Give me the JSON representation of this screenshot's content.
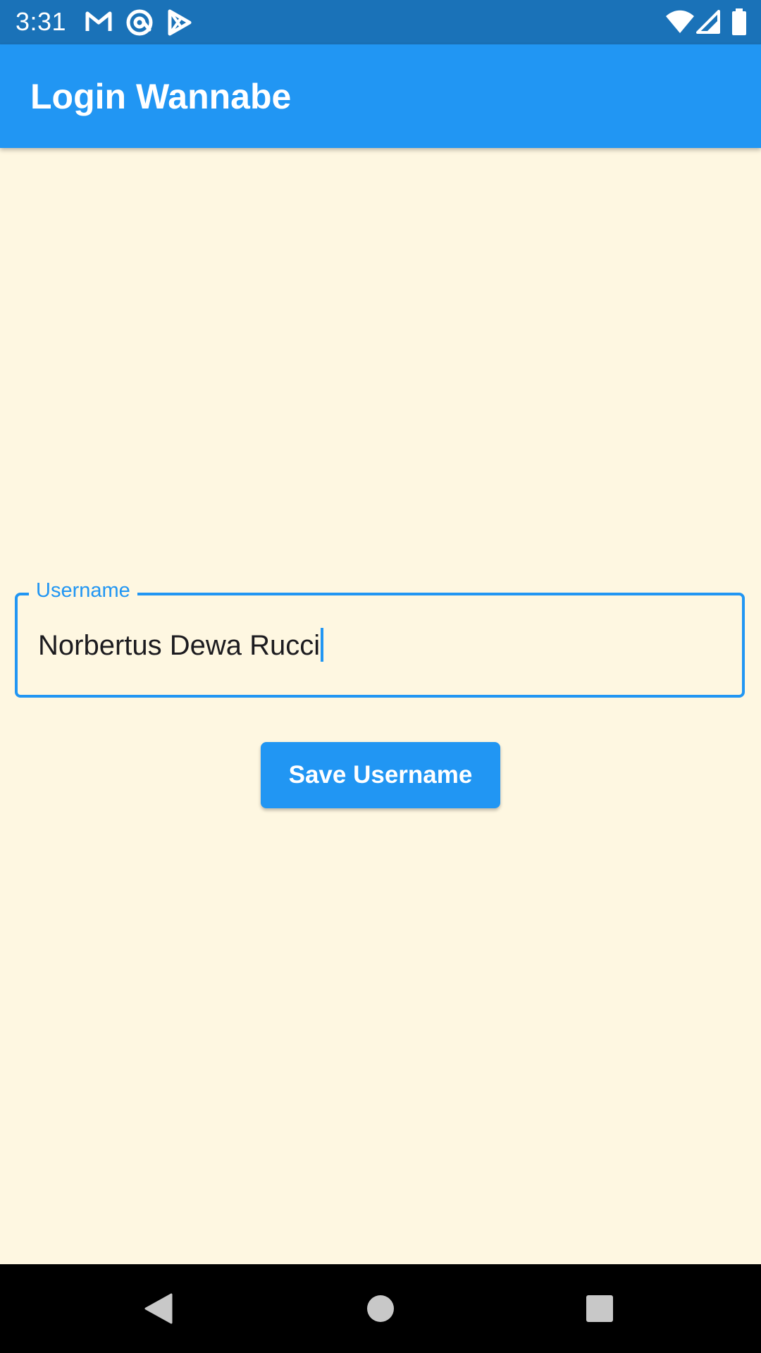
{
  "status_bar": {
    "time": "3:31",
    "left_icons": [
      "gmail-icon",
      "at-sign-icon",
      "play-store-icon"
    ],
    "right_icons": [
      "wifi-icon",
      "cell-signal-icon",
      "battery-icon"
    ]
  },
  "app_bar": {
    "title": "Login Wannabe"
  },
  "form": {
    "username_label": "Username",
    "username_value": "Norbertus Dewa Rucci",
    "save_button_label": "Save Username"
  },
  "nav_bar": {
    "icons": [
      "back-icon",
      "home-icon",
      "recents-icon"
    ]
  },
  "colors": {
    "primary": "#2196F3",
    "status_bar": "#1A72B8",
    "background": "#FEF7E1",
    "nav_bar": "#000000"
  }
}
